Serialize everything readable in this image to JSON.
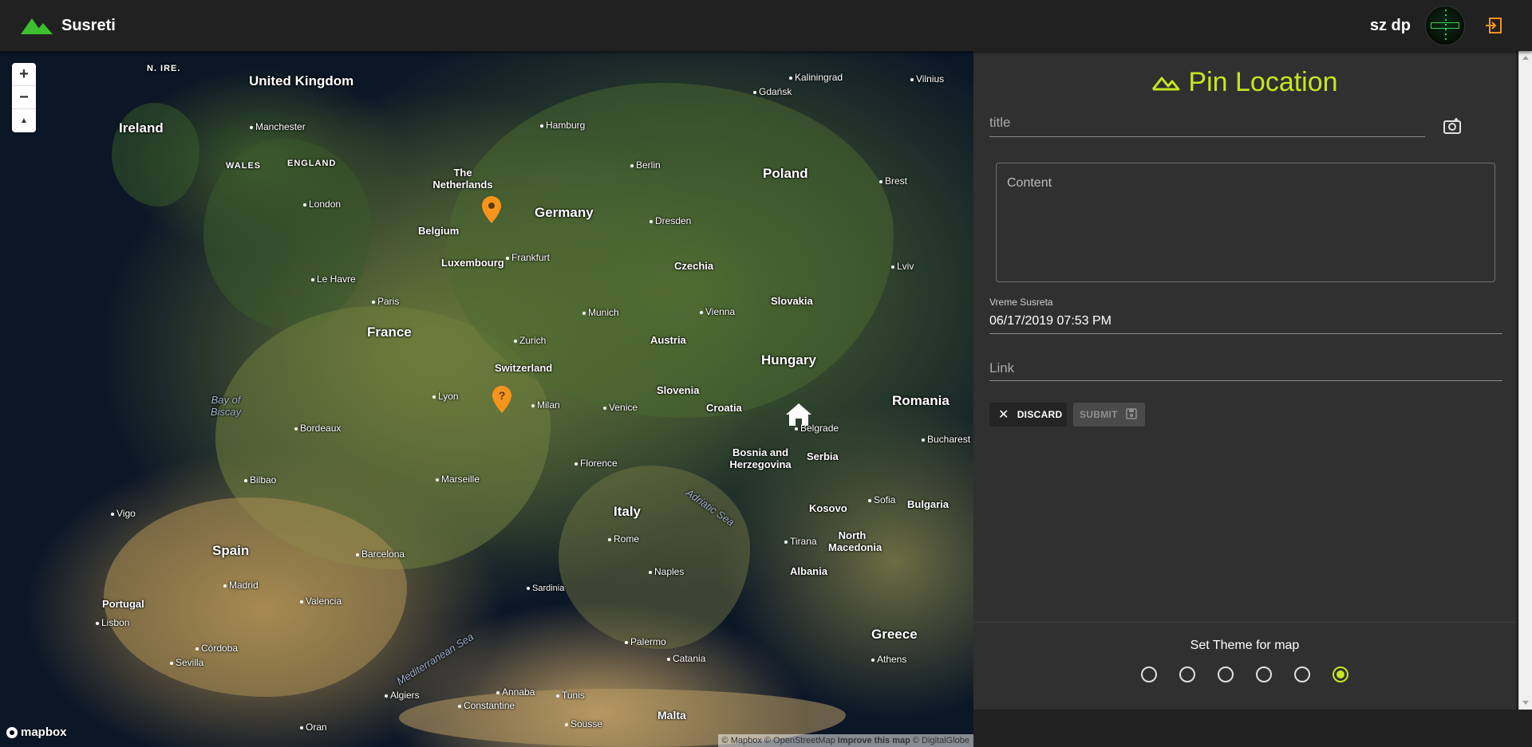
{
  "header": {
    "app_name": "Susreti",
    "username": "sz dp",
    "logo_icon": "mountain-icon",
    "logout_icon": "logout-icon"
  },
  "colors": {
    "accent": "#c6e61e",
    "brand_green": "#3dbf2f",
    "marker_orange": "#f7941d",
    "panel_bg": "#303030",
    "header_bg": "#212121"
  },
  "map": {
    "controls": {
      "zoom_in": "+",
      "zoom_out": "−",
      "compass": "▲"
    },
    "logo": "mapbox",
    "attribution": {
      "prefix": "© Mapbox © OpenStreetMap",
      "improve": "Improve this map",
      "suffix": "© DigitalGlobe"
    },
    "countries": [
      "United Kingdom",
      "Ireland",
      "France",
      "Germany",
      "Poland",
      "Czechia",
      "Slovakia",
      "Austria",
      "Hungary",
      "Romania",
      "Switzerland",
      "Slovenia",
      "Croatia",
      "Bosnia and Herzegovina",
      "Serbia",
      "Kosovo",
      "North Macedonia",
      "Albania",
      "Bulgaria",
      "Greece",
      "Italy",
      "Spain",
      "Portugal",
      "Belgium",
      "Luxembourg",
      "The Netherlands",
      "Malta"
    ],
    "regions": [
      "N. IRE.",
      "WALES",
      "ENGLAND"
    ],
    "cities": [
      "Manchester",
      "London",
      "Le Havre",
      "Paris",
      "Bordeaux",
      "Lyon",
      "Marseille",
      "Bilbao",
      "Vigo",
      "Madrid",
      "Lisbon",
      "Valencia",
      "Barcelona",
      "Córdoba",
      "Sevilla",
      "Algiers",
      "Constantine",
      "Annaba",
      "Tunis",
      "Sousse",
      "Oran",
      "Hamburg",
      "Berlin",
      "Dresden",
      "Frankfurt",
      "Munich",
      "Zurich",
      "Milan",
      "Venice",
      "Florence",
      "Rome",
      "Naples",
      "Palermo",
      "Catania",
      "Sardinia",
      "Vienna",
      "Gdańsk",
      "Kaliningrad",
      "Vilnius",
      "Brest",
      "Lviv",
      "Belgrade",
      "Bucharest",
      "Sofia",
      "Tirana",
      "Athens"
    ],
    "seas": [
      "Bay of Biscay",
      "Mediterranean Sea",
      "Adriatic Sea"
    ],
    "markers": [
      {
        "name": "marker-germany",
        "icon": "map-pin-icon"
      },
      {
        "name": "marker-alps",
        "icon": "map-pin-question-icon"
      },
      {
        "name": "marker-home-belgrade",
        "icon": "home-icon"
      }
    ]
  },
  "panel": {
    "title": "Pin Location",
    "title_icon": "mountain-outline-icon",
    "title_field_placeholder": "title",
    "photo_icon": "add-photo-icon",
    "content_placeholder": "Content",
    "datetime_label": "Vreme Susreta",
    "datetime_value": "06/17/2019 07:53 PM",
    "link_placeholder": "Link",
    "discard_label": "DISCARD",
    "submit_label": "SUBMIT",
    "theme_title": "Set Theme for map",
    "theme_options_count": 6,
    "theme_selected_index": 5
  }
}
